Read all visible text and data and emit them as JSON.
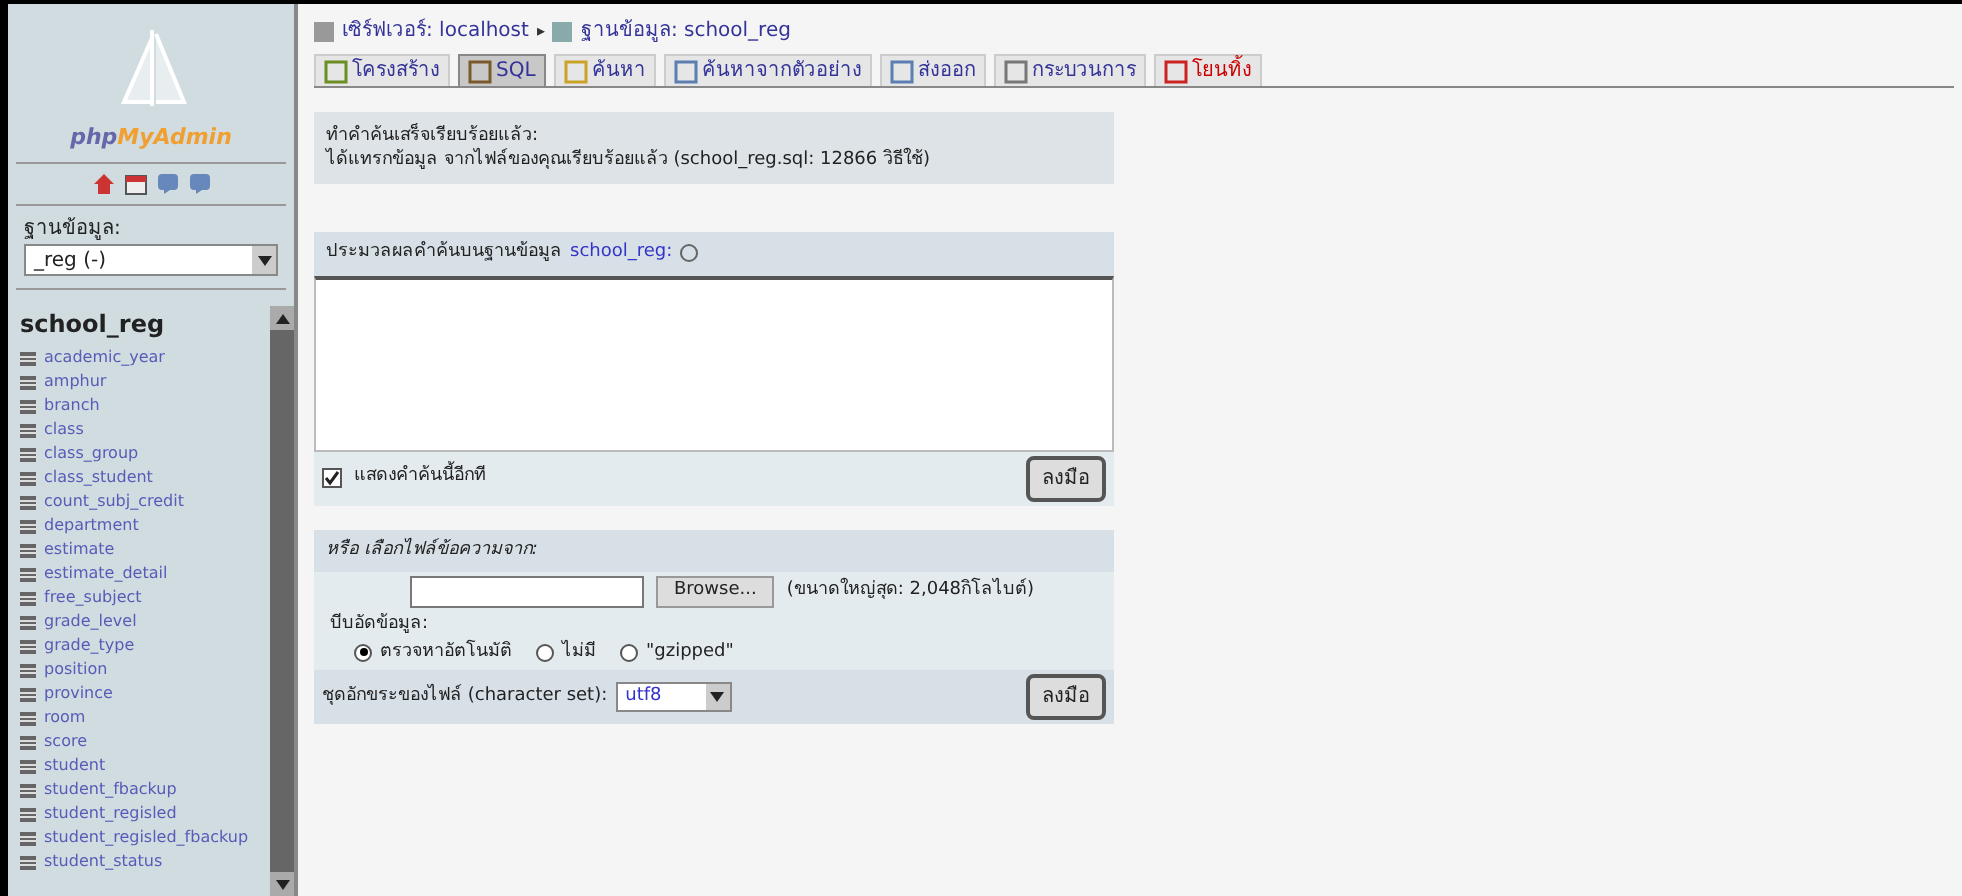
{
  "sidebar": {
    "logo": {
      "php": "php",
      "brand": "MyAdmin"
    },
    "database_label": "ฐานข้อมูล:",
    "database_select": "_reg (-)",
    "database_name": "school_reg",
    "tables": [
      "academic_year",
      "amphur",
      "branch",
      "class",
      "class_group",
      "class_student",
      "count_subj_credit",
      "department",
      "estimate",
      "estimate_detail",
      "free_subject",
      "grade_level",
      "grade_type",
      "position",
      "province",
      "room",
      "score",
      "student",
      "student_fbackup",
      "student_regisled",
      "student_regisled_fbackup",
      "student_status"
    ]
  },
  "breadcrumb": {
    "server": "เซิร์ฟเวอร์: localhost",
    "separator": "▸",
    "database": "ฐานข้อมูล: school_reg"
  },
  "tabs": [
    {
      "label": "โครงสร้าง",
      "selected": false,
      "kind": "normal"
    },
    {
      "label": "SQL",
      "selected": true,
      "kind": "normal"
    },
    {
      "label": "ค้นหา",
      "selected": false,
      "kind": "normal"
    },
    {
      "label": "ค้นหาจากตัวอย่าง",
      "selected": false,
      "kind": "normal"
    },
    {
      "label": "ส่งออก",
      "selected": false,
      "kind": "normal"
    },
    {
      "label": "กระบวนการ",
      "selected": false,
      "kind": "normal"
    },
    {
      "label": "โยนทิ้ง",
      "selected": false,
      "kind": "danger"
    }
  ],
  "message": {
    "line_1": "ทำคำค้นเสร็จเรียบร้อยแล้ว:",
    "line_2": "ได้แทรกข้อมูล จากไฟล์ของคุณเรียบร้อยแล้ว (school_reg.sql: 12866 วิธีใช้)"
  },
  "query_panel": {
    "heading": "ประมวลผลคำค้นบนฐานข้อมูล",
    "database_link": "school_reg:",
    "show_again": {
      "label": "แสดงคำค้นนี้อีกที",
      "checked": true
    },
    "go_button": "ลงมือ"
  },
  "file_panel": {
    "heading": "หรือ เลือกไฟล์ข้อความจาก:",
    "browse_button": "Browse...",
    "max_size": "(ขนาดใหญ่สุด: 2,048กิโลไบต์)",
    "compression_label": "บีบอัดข้อมูล:",
    "compression_options": [
      {
        "label": "ตรวจหาอัตโนมัติ",
        "selected": true
      },
      {
        "label": "ไม่มี",
        "selected": false
      },
      {
        "label": "\"gzipped\"",
        "selected": false
      }
    ],
    "charset_label": "ชุดอักขระของไฟล์ (character set):",
    "charset_value": "utf8",
    "go_button": "ลงมือ"
  }
}
